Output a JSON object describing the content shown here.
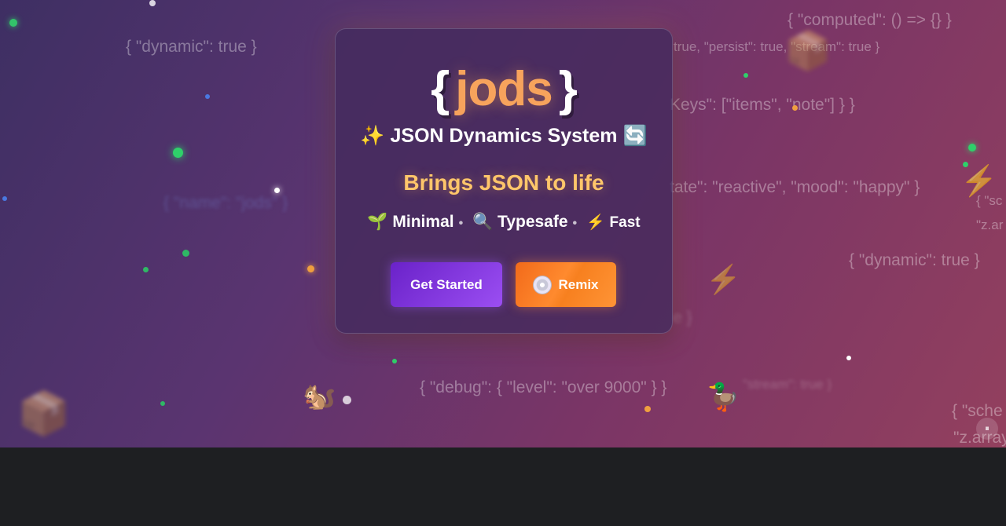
{
  "brand": {
    "open_brace": "{",
    "name": "jods",
    "close_brace": "}"
  },
  "tagline": {
    "sparkle": "✨",
    "text": "JSON Dynamics System",
    "cycle": "🔄"
  },
  "headline": "Brings JSON to life",
  "features": [
    {
      "icon": "🌱",
      "label": "Minimal"
    },
    {
      "icon": "🔍",
      "label": "Typesafe"
    },
    {
      "icon": "⚡",
      "label": "Fast"
    }
  ],
  "feature_separator": "•",
  "buttons": {
    "get_started": "Get Started",
    "remix": "Remix"
  },
  "pause_icon": "⏸",
  "floating_code": [
    "{ \"dynamic\": true }",
    "{ \"computed\": () => {} }",
    "true, \"persist\": true, \"stream\": true }",
    "Keys\": [\"items\", \"note\"] } }",
    "tate\": \"reactive\", \"mood\": \"happy\" }",
    "{ \"dynamic\": true }",
    "{ \"debug\": { \"level\": \"over 9000\" } }",
    "{ \"sc",
    "\"z.ar",
    "{ \"sche",
    "\"z.array",
    "{ \"name\": \"jods\" }",
    "e }",
    "\"stream\": true }"
  ],
  "emoji": {
    "chipmunk": "🐿️",
    "duck": "🦆",
    "bolt": "⚡",
    "box": "📦"
  },
  "colors": {
    "accent_orange": "#f7a35c",
    "headline_gold": "#ffc66a",
    "button_purple": "#7b2fe0",
    "button_orange": "#f7801f"
  }
}
